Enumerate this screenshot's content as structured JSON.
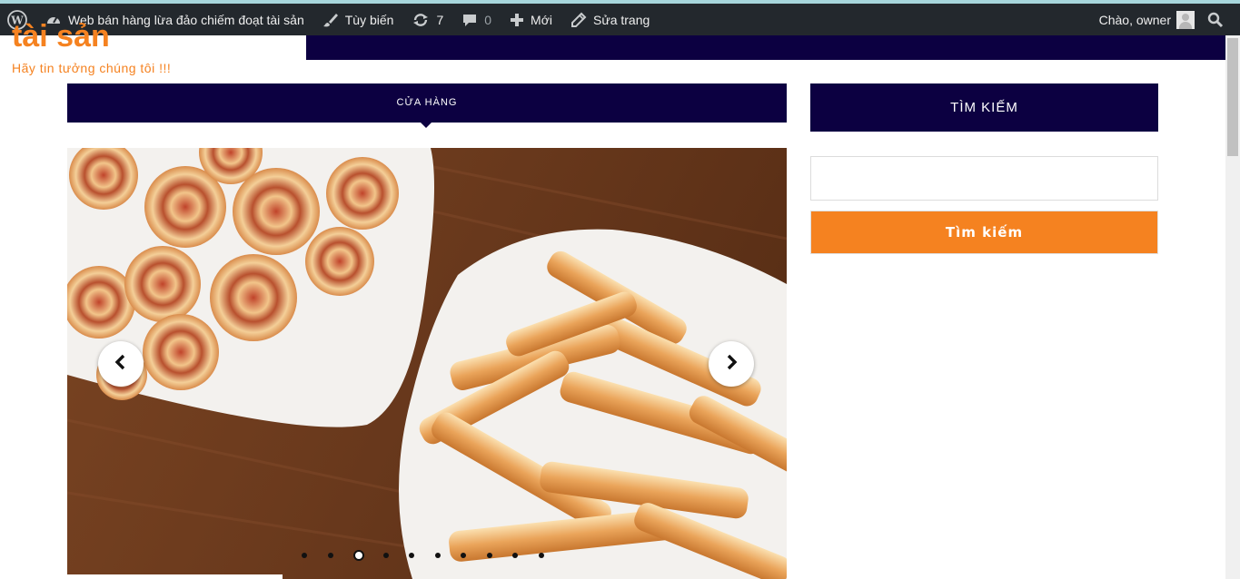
{
  "admin_bar": {
    "site_name": "Web bán hàng lừa đảo chiếm đoạt tài sản",
    "customize_label": "Tùy biến",
    "updates_count": "7",
    "comments_count": "0",
    "new_label": "Mới",
    "edit_label": "Sửa trang",
    "greeting": "Chào, owner"
  },
  "site": {
    "title": "tài sản",
    "tagline": "Hãy tin tưởng chúng tôi !!!"
  },
  "nav": {
    "items": [
      {
        "label": "CỬA HÀNG"
      }
    ]
  },
  "slider": {
    "dot_count": 10,
    "active_dot": 2
  },
  "sidebar": {
    "widget_title": "TÌM KIẾM",
    "search_placeholder": "",
    "search_button": "Tìm kiếm"
  },
  "colors": {
    "accent": "#f58220",
    "navy": "#0c0041",
    "admin_bar": "#23282d"
  }
}
